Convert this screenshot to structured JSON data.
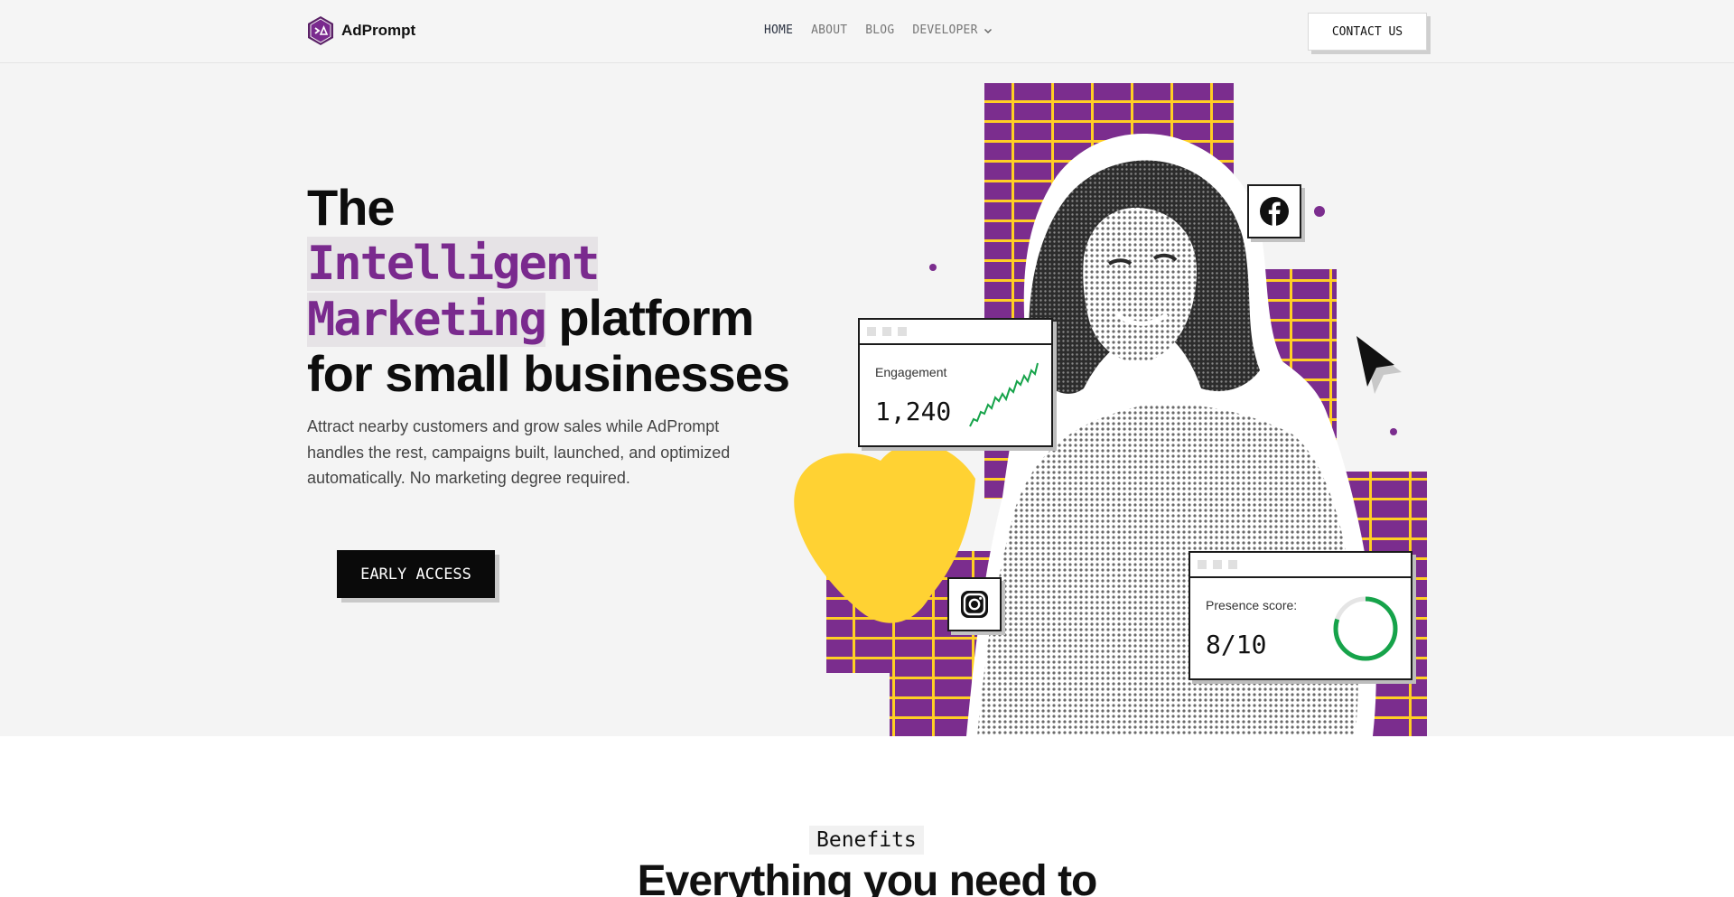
{
  "brand": {
    "name": "AdPrompt",
    "accent": "#7a2a8e"
  },
  "nav": {
    "items": [
      {
        "label": "HOME",
        "active": true
      },
      {
        "label": "ABOUT",
        "active": false
      },
      {
        "label": "BLOG",
        "active": false
      },
      {
        "label": "DEVELOPER",
        "active": false,
        "has_dropdown": true
      }
    ],
    "contact_label": "CONTACT US"
  },
  "hero": {
    "headline_line1": "The",
    "headline_highlight1": "Intelligent",
    "headline_highlight2": "Marketing",
    "headline_rest2": " platform",
    "headline_line4": "for small businesses",
    "subtitle": "Attract nearby customers and grow sales while AdPrompt handles the rest, campaigns built, launched, and optimized automatically. No marketing degree required.",
    "cta_label": "EARLY ACCESS"
  },
  "cards": {
    "engagement": {
      "label": "Engagement",
      "value": "1,240",
      "color": "#16a34a"
    },
    "presence": {
      "label": "Presence score:",
      "value": "8/10",
      "score": 8,
      "max": 10,
      "color": "#16a34a"
    }
  },
  "colors": {
    "purple": "#7b2d8e",
    "yellow": "#ffd233",
    "dark": "#0a0a0a"
  },
  "icons": [
    "facebook-icon",
    "instagram-icon",
    "cursor-arrow-icon",
    "chevron-down-icon"
  ],
  "benefits": {
    "badge": "Benefits",
    "title": "Everything you need to"
  }
}
